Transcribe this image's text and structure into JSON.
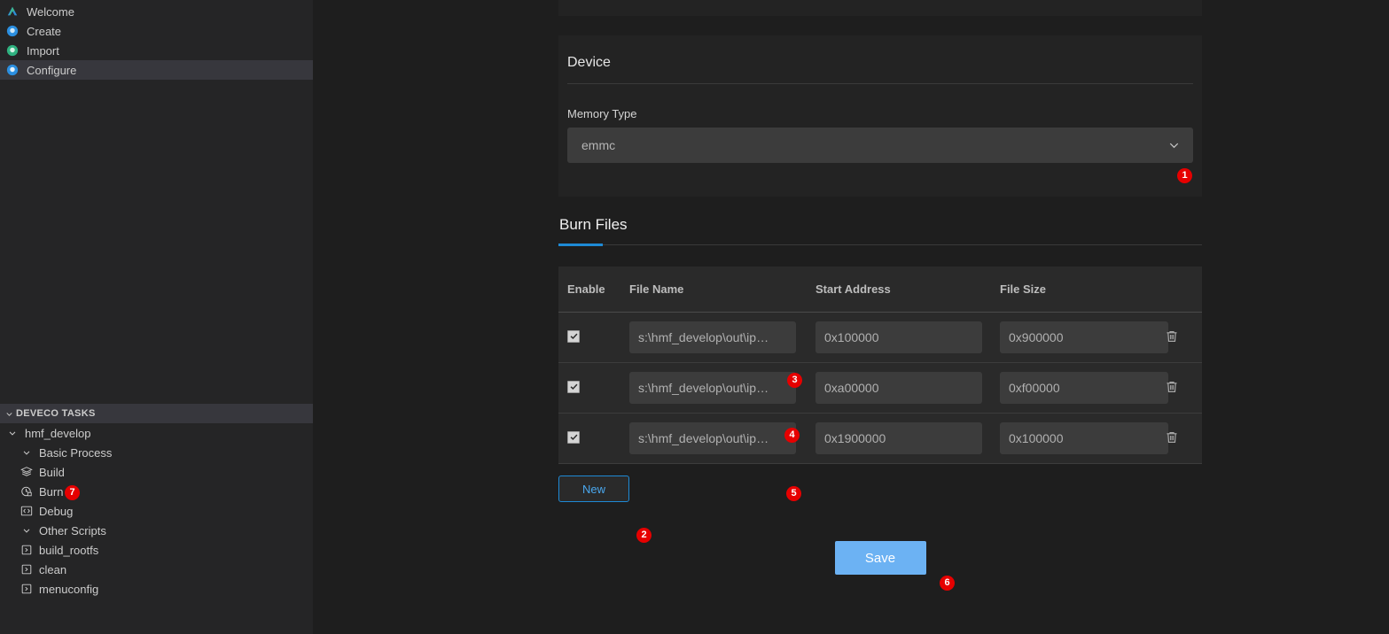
{
  "sidebar": {
    "nav_items": [
      {
        "label": "Welcome",
        "icon": "welcome-logo-icon",
        "active": false
      },
      {
        "label": "Create",
        "icon": "create-circle-icon",
        "active": false
      },
      {
        "label": "Import",
        "icon": "import-circle-icon",
        "active": false
      },
      {
        "label": "Configure",
        "icon": "configure-circle-icon",
        "active": true
      }
    ],
    "tasks_header": "DEVECO TASKS",
    "tasks": [
      {
        "label": "hmf_develop",
        "icon": "chevron-down-icon",
        "indent": 0,
        "type": "group"
      },
      {
        "label": "Basic Process",
        "icon": "chevron-down-icon",
        "indent": 1,
        "type": "group"
      },
      {
        "label": "Build",
        "icon": "layers-icon",
        "indent": 1,
        "type": "task"
      },
      {
        "label": "Burn",
        "icon": "burn-icon",
        "indent": 1,
        "type": "task",
        "badge": "7"
      },
      {
        "label": "Debug",
        "icon": "code-icon",
        "indent": 1,
        "type": "task"
      },
      {
        "label": "Other Scripts",
        "icon": "chevron-down-icon",
        "indent": 1,
        "type": "group"
      },
      {
        "label": "build_rootfs",
        "icon": "script-icon",
        "indent": 2,
        "type": "task"
      },
      {
        "label": "clean",
        "icon": "script-icon",
        "indent": 2,
        "type": "task"
      },
      {
        "label": "menuconfig",
        "icon": "script-icon",
        "indent": 2,
        "type": "task"
      }
    ]
  },
  "device": {
    "title": "Device",
    "memory_type_label": "Memory Type",
    "memory_type_value": "emmc",
    "chevron_icon": "chevron-down-icon",
    "badge": "1"
  },
  "burn_files": {
    "title": "Burn Files",
    "columns": [
      "Enable",
      "File Name",
      "Start Address",
      "File Size"
    ],
    "rows": [
      {
        "enabled": true,
        "file_name": "s:\\hmf_develop\\out\\ip…",
        "start_address": "0x100000",
        "file_size": "0x900000",
        "badge": "3",
        "delete_icon": "trash-icon"
      },
      {
        "enabled": true,
        "file_name": "s:\\hmf_develop\\out\\ip…",
        "start_address": "0xa00000",
        "file_size": "0xf00000",
        "badge": "4",
        "delete_icon": "trash-icon"
      },
      {
        "enabled": true,
        "file_name": "s:\\hmf_develop\\out\\ip…",
        "start_address": "0x1900000",
        "file_size": "0x100000",
        "badge": "5",
        "delete_icon": "trash-icon"
      }
    ],
    "new_button": "New",
    "new_badge": "2",
    "save_button": "Save",
    "save_badge": "6"
  },
  "colors": {
    "accent_blue": "#1e8ad6",
    "save_blue": "#6cb2f3",
    "badge_red": "#e60000",
    "sidebar_bg": "#252526",
    "main_bg": "#1e1e1e",
    "card_bg": "#232323",
    "table_bg": "#2a2a2a",
    "input_bg": "#3c3c3c"
  }
}
